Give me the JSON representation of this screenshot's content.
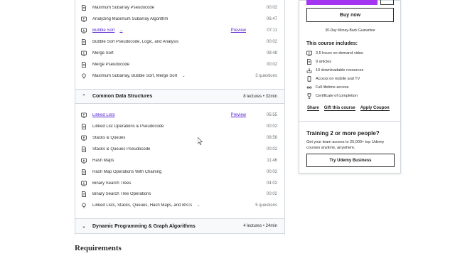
{
  "section1": {
    "lectures": [
      {
        "title": "Maximum Subarray Pseudocode",
        "duration": "00:02",
        "icon": "file-icon"
      },
      {
        "title": "Analyzing Maximum Subarray Algorithm",
        "duration": "06:47",
        "icon": "video-icon"
      },
      {
        "title": "Bubble Sort",
        "duration": "07:11",
        "icon": "video-icon",
        "preview": "Preview"
      },
      {
        "title": "Bubble Sort Pseudocode, Logic, and Analysis",
        "duration": "00:02",
        "icon": "file-icon"
      },
      {
        "title": "Merge Sort",
        "duration": "08:48",
        "icon": "video-icon"
      },
      {
        "title": "Merge Pseudocode",
        "duration": "00:02",
        "icon": "file-icon"
      },
      {
        "title": "Maximum Subarray, Bubble Sort, Merge Sort",
        "duration": "3 questions",
        "icon": "quiz-icon"
      }
    ]
  },
  "section2": {
    "title": "Common Data Structures",
    "meta": "8 lectures • 32min",
    "lectures": [
      {
        "title": "Linked Lists",
        "duration": "05:55",
        "icon": "video-icon",
        "preview": "Preview"
      },
      {
        "title": "Linked List Operations & Pseudocode",
        "duration": "00:02",
        "icon": "file-icon"
      },
      {
        "title": "Stacks & Queues",
        "duration": "09:56",
        "icon": "video-icon"
      },
      {
        "title": "Stacks & Queues Pseudocode",
        "duration": "00:02",
        "icon": "file-icon"
      },
      {
        "title": "Hash Maps",
        "duration": "11:46",
        "icon": "video-icon"
      },
      {
        "title": "Hash Map Operations With Chaining",
        "duration": "00:02",
        "icon": "file-icon"
      },
      {
        "title": "Binary Search Trees",
        "duration": "04:02",
        "icon": "video-icon"
      },
      {
        "title": "Binary Search Tree Operations",
        "duration": "00:02",
        "icon": "file-icon"
      },
      {
        "title": "Linked Lists, Stacks, Queues, Hash Maps, and BSTs",
        "duration": "5 questions",
        "icon": "quiz-icon"
      }
    ]
  },
  "section3": {
    "title": "Dynamic Programming & Graph Algorithms",
    "meta": "4 lectures • 24min"
  },
  "requirements_heading": "Requirements",
  "sidebar": {
    "buy_now": "Buy now",
    "money_back": "30-Day Money-Back Guarantee",
    "includes_title": "This course includes:",
    "includes": [
      {
        "text": "3.5 hours on-demand video",
        "icon": "video-icon"
      },
      {
        "text": "9 articles",
        "icon": "file-icon"
      },
      {
        "text": "10 downloadable resources",
        "icon": "download-icon"
      },
      {
        "text": "Access on mobile and TV",
        "icon": "mobile-icon"
      },
      {
        "text": "Full lifetime access",
        "icon": "infinity-icon"
      },
      {
        "text": "Certificate of completion",
        "icon": "trophy-icon"
      }
    ],
    "share": "Share",
    "gift": "Gift this course",
    "coupon": "Apply Coupon",
    "team_title": "Training 2 or more people?",
    "team_desc": "Get your team access to 25,000+ top Udemy courses anytime, anywhere.",
    "team_button": "Try Udemy Business"
  },
  "colors": {
    "accent": "#5624d0",
    "cart": "#a435f0",
    "border": "#d1d7dc"
  }
}
